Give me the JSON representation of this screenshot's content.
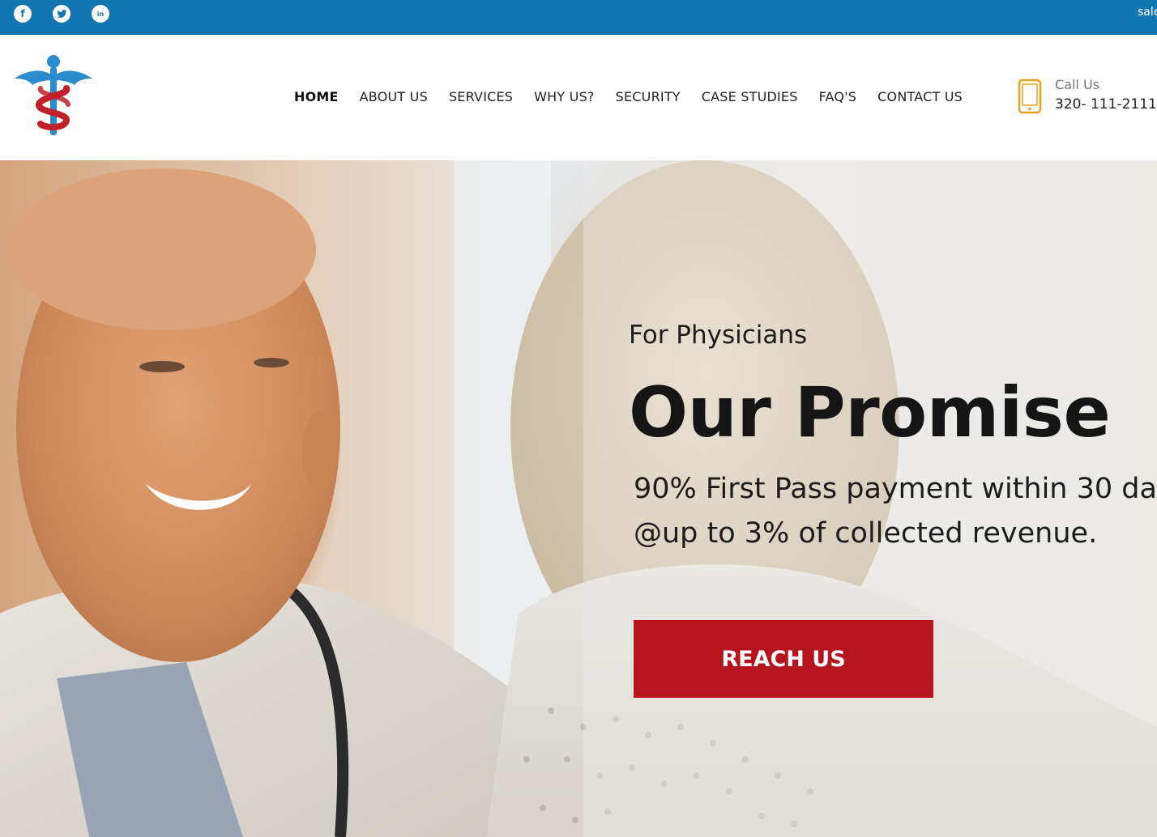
{
  "topbar": {
    "email_partial": "sale",
    "social": [
      "facebook-icon",
      "twitter-icon",
      "linkedin-icon"
    ]
  },
  "nav": {
    "items": [
      "HOME",
      "ABOUT US",
      "SERVICES",
      "WHY US?",
      "SECURITY",
      "CASE STUDIES",
      "FAQ'S",
      "CONTACT US"
    ],
    "active": "HOME"
  },
  "contact": {
    "label": "Call Us",
    "phone": "320- 111-2111"
  },
  "hero": {
    "kicker": "For Physicians",
    "headline": "Our Promise",
    "line1": "90% First Pass payment within 30 da",
    "line2": "@up to 3% of collected revenue.",
    "cta": "REACH US"
  },
  "colors": {
    "topbar": "#1276b3",
    "cta": "#b5141f",
    "logo_blue": "#2a8ccd",
    "logo_red": "#c0202a",
    "phone_icon": "#f0a020"
  }
}
